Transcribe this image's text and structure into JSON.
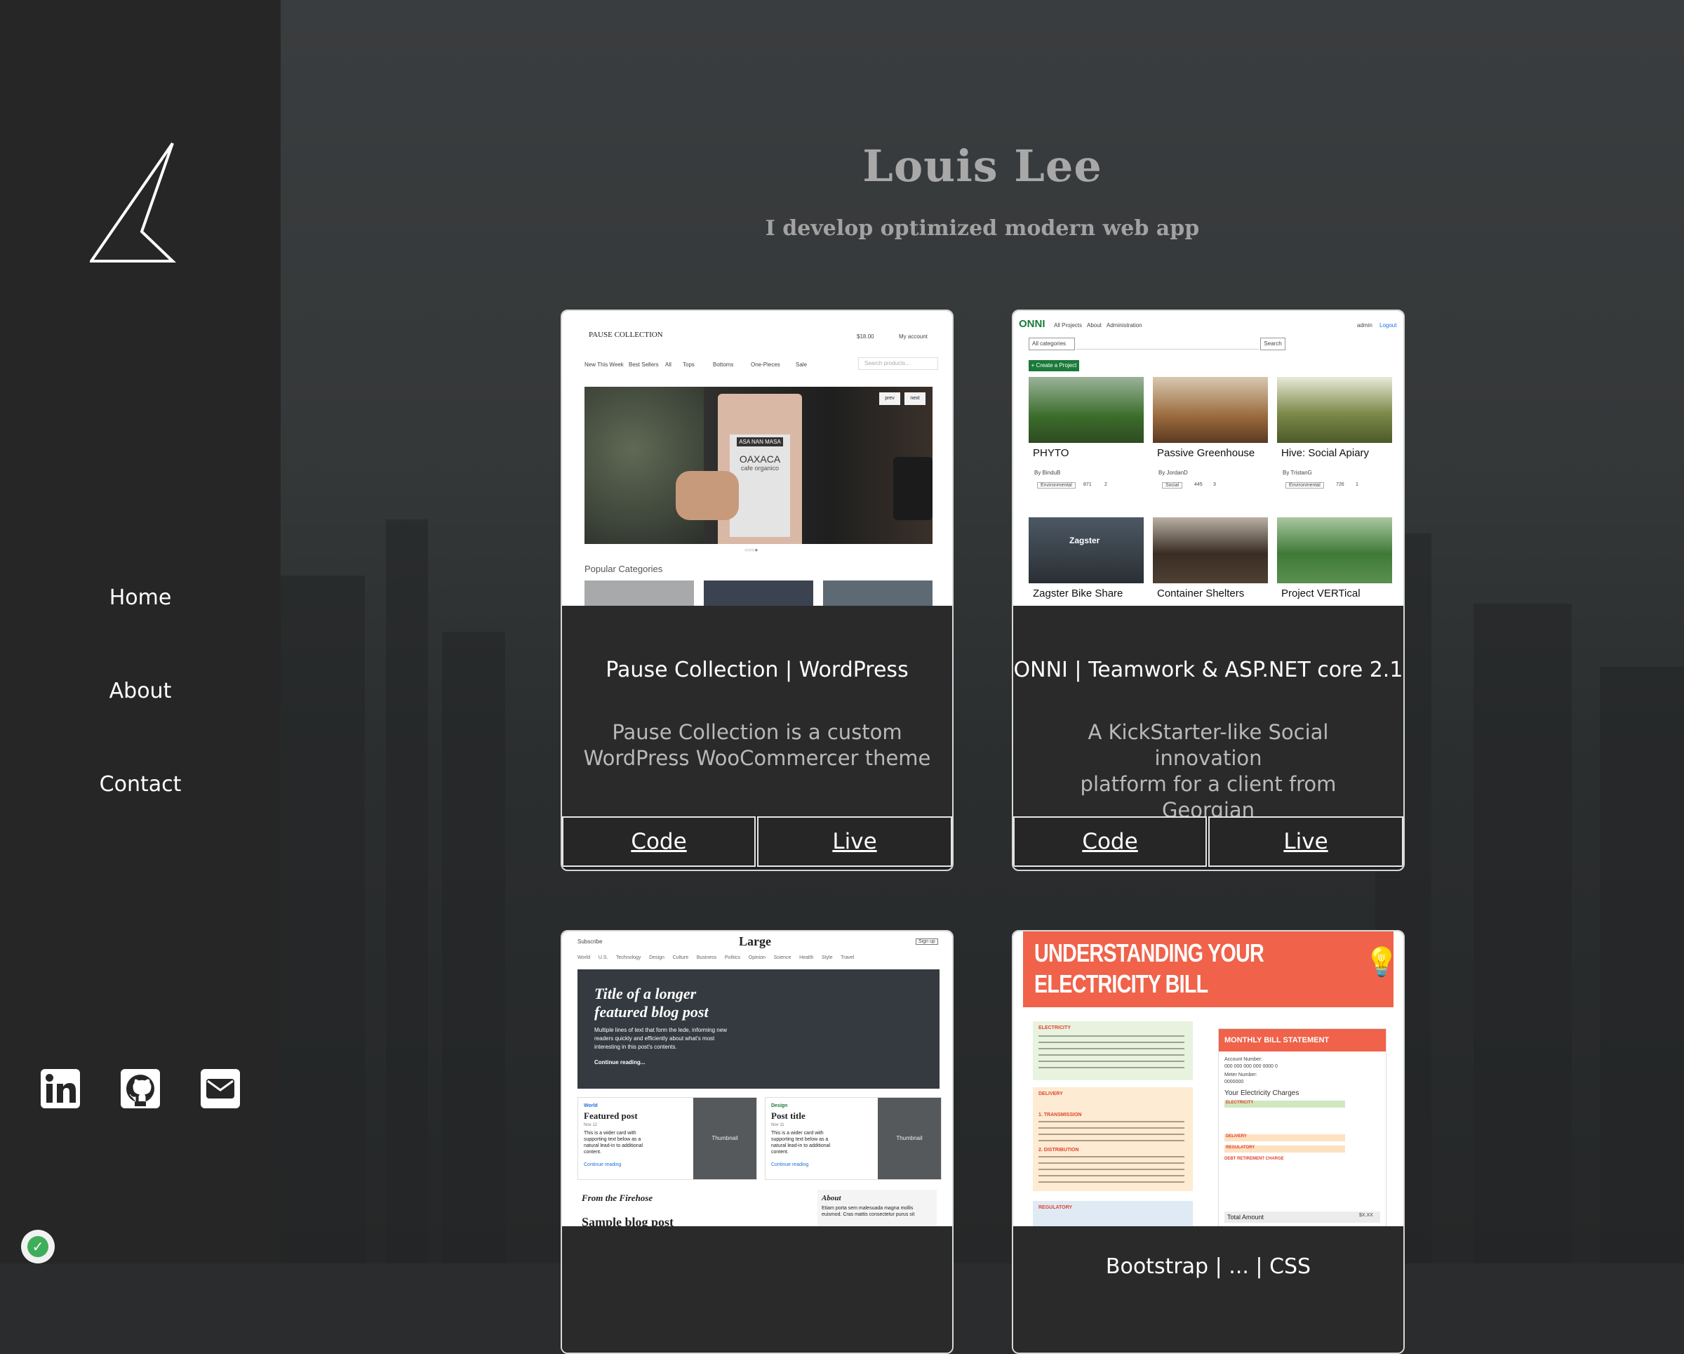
{
  "sidebar": {
    "nav": [
      {
        "label": "Home"
      },
      {
        "label": "About"
      },
      {
        "label": "Contact"
      }
    ],
    "social": [
      "linkedin-icon",
      "github-icon",
      "mail-icon"
    ]
  },
  "hero": {
    "title": "Louis Lee",
    "subtitle": "I develop optimized modern web app"
  },
  "cards": [
    {
      "title": "Pause Collection | WordPress",
      "desc_line1": "Pause Collection is a custom",
      "desc_line2": "WordPress WooCommercer theme",
      "code": "Code",
      "live": "Live",
      "shot": {
        "brand": "PAUSE COLLECTION",
        "cart": "$18.00",
        "account": "My account",
        "menu": [
          "New This Week",
          "Best Sellers",
          "All",
          "Tops",
          "Bottoms",
          "One-Pieces",
          "Sale"
        ],
        "search": "Search products...",
        "prev": "prev",
        "next": "next",
        "bag_top": "ASA NAN MASA",
        "bag_title": "OAXACA",
        "bag_sub": "cafe organico",
        "popular": "Popular Categories"
      }
    },
    {
      "title": "ONNI | Teamwork & ASP.NET core 2.1",
      "desc_line1": "A KickStarter-like Social innovation",
      "desc_line2": "platform for a client from Georgian",
      "code": "Code",
      "live": "Live",
      "shot": {
        "brand": "ONNI",
        "nav": [
          "All Projects",
          "About",
          "Administration"
        ],
        "admin": "admin",
        "logout": "Logout",
        "select": "All categories",
        "search_btn": "Search",
        "create": "+ Create a Project",
        "projects": [
          {
            "name": "PHYTO",
            "by": "By BinduB",
            "tag": "Environmental",
            "views": "871",
            "likes": "2"
          },
          {
            "name": "Passive Greenhouse",
            "by": "By JordanD",
            "tag": "Social",
            "views": "445",
            "likes": "3"
          },
          {
            "name": "Hive: Social Apiary",
            "by": "By TristanG",
            "tag": "Environmental",
            "views": "726",
            "likes": "1"
          },
          {
            "name": "Zagster Bike Share"
          },
          {
            "name": "Container Shelters"
          },
          {
            "name": "Project VERTical"
          }
        ],
        "zagster": "Zagster"
      }
    },
    {
      "shot": {
        "subscribe": "Subscribe",
        "brand": "Large",
        "signup": "Sign up",
        "nav": [
          "World",
          "U.S.",
          "Technology",
          "Design",
          "Culture",
          "Business",
          "Politics",
          "Opinion",
          "Science",
          "Health",
          "Style",
          "Travel"
        ],
        "feature_title_1": "Title of a longer",
        "feature_title_2": "featured blog post",
        "feature_text_1": "Multiple lines of text that form the lede, informing new",
        "feature_text_2": "readers quickly and efficiently about what's most",
        "feature_text_3": "interesting in this post's contents.",
        "continue": "Continue reading...",
        "cards": [
          {
            "cat": "World",
            "title": "Featured post",
            "date": "Nov 12",
            "text": "This is a wider card with supporting text below as a natural lead-in to additional content.",
            "link": "Continue reading",
            "thumb": "Thumbnail"
          },
          {
            "cat": "Design",
            "title": "Post title",
            "date": "Nov 11",
            "text": "This is a wider card with supporting text below as a natural lead-in to additional content.",
            "link": "Continue reading",
            "thumb": "Thumbnail"
          }
        ],
        "firehose": "From the Firehose",
        "sample": "Sample blog post",
        "about": "About",
        "about_text": "Etiam porta sem malesuada magna mollis euismod. Cras mattis consectetur purus sit"
      }
    },
    {
      "title_partial": "Bootstrap | ... | CSS",
      "shot": {
        "header_1": "UNDERSTANDING YOUR",
        "header_2": "ELECTRICITY BILL",
        "monthly": "MONTHLY BILL STATEMENT",
        "account_label": "Account Number:",
        "account": "000 000 000 000 0000 0",
        "meter_label": "Meter Number:",
        "meter": "0000000",
        "charges": "Your Electricity Charges",
        "electricity": "ELECTRICITY",
        "delivery": "DELIVERY",
        "regulatory": "REGULATORY",
        "debt": "DEBT RETIREMENT CHARGE",
        "transmission": "1. TRANSMISSION",
        "distribution": "2. DISTRIBUTION",
        "total_label": "Total Amount",
        "total": "$X.XX"
      }
    }
  ]
}
